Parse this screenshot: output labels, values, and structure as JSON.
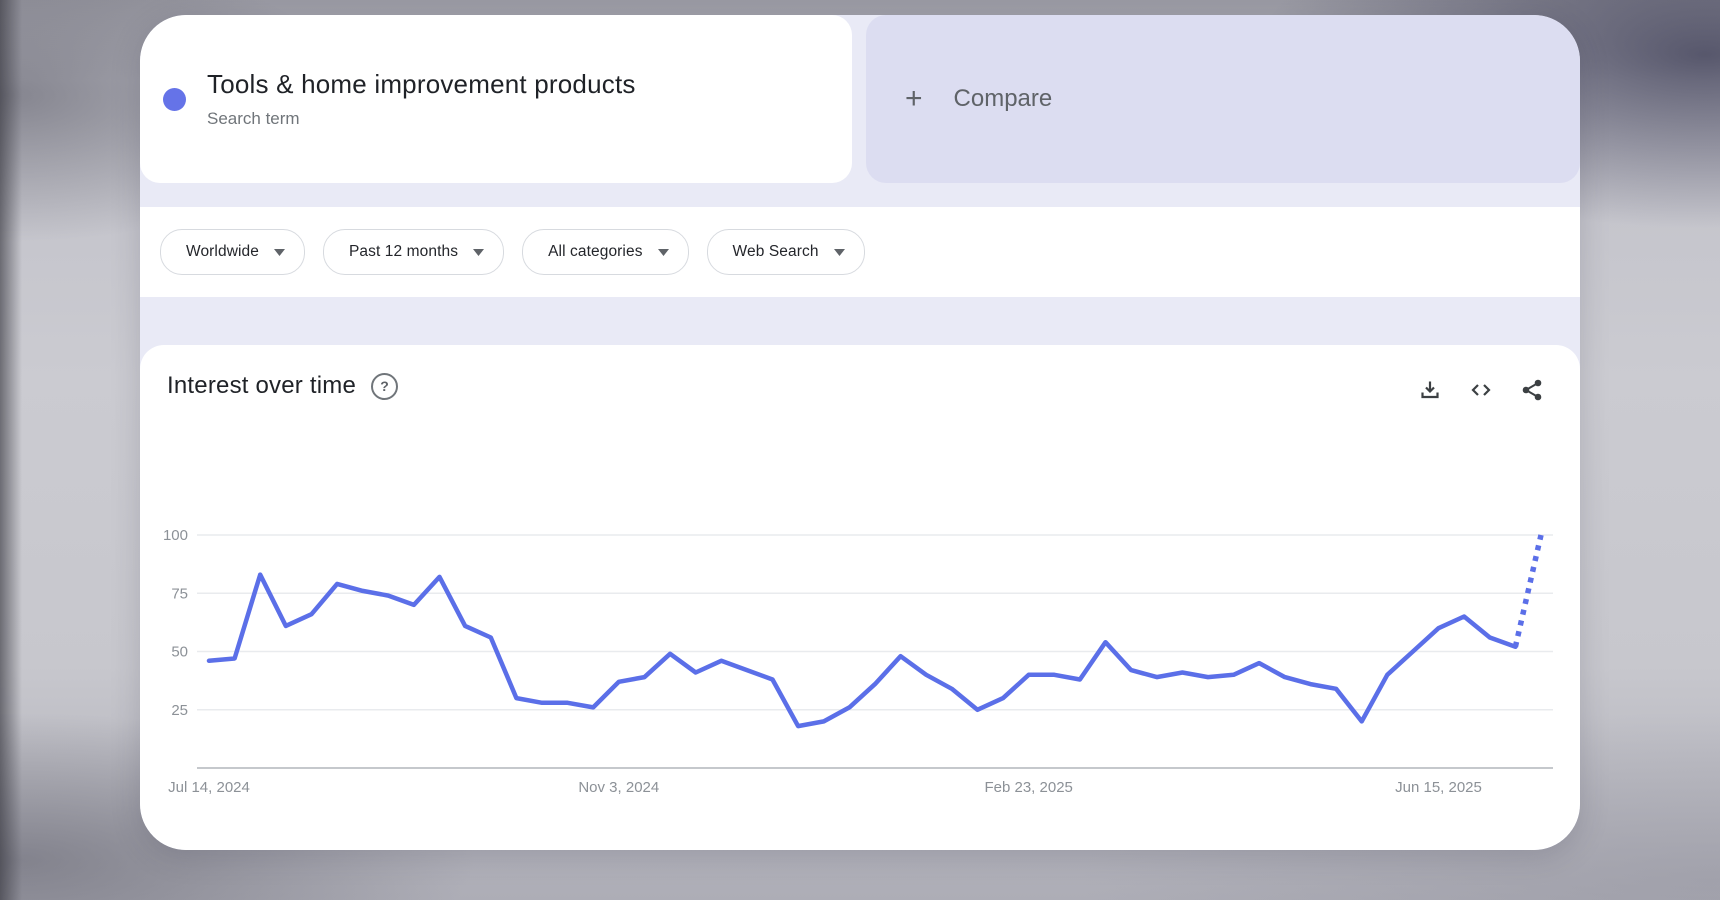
{
  "term_card": {
    "title": "Tools & home improvement products",
    "subtitle": "Search term",
    "dot_color": "#6573e8"
  },
  "compare_card": {
    "plus": "+",
    "label": "Compare"
  },
  "filters": {
    "region": "Worldwide",
    "time": "Past 12 months",
    "category": "All categories",
    "search_type": "Web Search"
  },
  "section": {
    "title": "Interest over time",
    "help_glyph": "?"
  },
  "chart_data": {
    "type": "line",
    "title": "Interest over time",
    "xlabel": "",
    "ylabel": "",
    "ylim": [
      0,
      100
    ],
    "grid": true,
    "frequency": "weekly",
    "x_tick_labels": [
      "Jul 14, 2024",
      "Nov 3, 2024",
      "Feb 23, 2025",
      "Jun 15, 2025"
    ],
    "x_tick_indices": [
      0,
      16,
      32,
      48
    ],
    "y_ticks": [
      25,
      50,
      75,
      100
    ],
    "line_color": "#5b6fe8",
    "grid_color": "#e9ebee",
    "axis_color": "#c5c8cc",
    "series": [
      {
        "name": "Tools & home improvement products",
        "values": [
          46,
          47,
          83,
          61,
          66,
          79,
          76,
          74,
          70,
          82,
          61,
          56,
          30,
          28,
          28,
          26,
          37,
          39,
          49,
          41,
          46,
          42,
          38,
          18,
          20,
          26,
          36,
          48,
          40,
          34,
          25,
          30,
          40,
          40,
          38,
          54,
          42,
          39,
          41,
          39,
          40,
          45,
          39,
          36,
          34,
          20,
          40,
          50,
          60,
          65,
          56,
          52,
          100
        ],
        "last_point_partial_dotted": true
      }
    ]
  }
}
